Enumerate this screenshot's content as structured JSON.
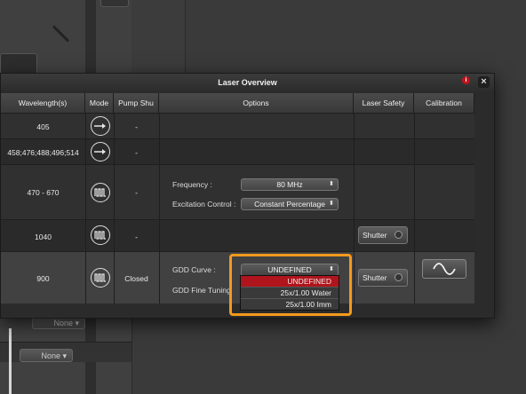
{
  "dialog": {
    "title": "Laser Overview",
    "info_glyph": "i",
    "close_glyph": "×"
  },
  "columns": [
    "Wavelength(s)",
    "Mode",
    "Pump Shu",
    "Options",
    "Laser Safety",
    "Calibration"
  ],
  "rows": [
    {
      "wavelength": "405",
      "mode_icon": "continuous-wave-icon",
      "pump_shutter": "-"
    },
    {
      "wavelength": "458;476;488;496;514",
      "mode_icon": "continuous-wave-icon",
      "pump_shutter": "-"
    },
    {
      "wavelength": "470 - 670",
      "mode_icon": "pulsed-icon",
      "pump_shutter": "-",
      "options": {
        "frequency_label": "Frequency :",
        "frequency_value": "80 MHz",
        "excitation_label": "Excitation Control :",
        "excitation_value": "Constant Percentage"
      }
    },
    {
      "wavelength": "1040",
      "mode_icon": "pulsed-icon",
      "pump_shutter": "-",
      "shutter_label": "Shutter"
    },
    {
      "wavelength": "900",
      "mode_icon": "pulsed-icon",
      "pump_shutter": "Closed",
      "options": {
        "gdd_curve_label": "GDD Curve :",
        "gdd_curve_value": "UNDEFINED",
        "gdd_fine_label": "GDD Fine Tuning"
      },
      "shutter_label": "Shutter",
      "calibration_icon": "sine-wave-icon"
    }
  ],
  "gdd_dropdown_options": [
    "UNDEFINED",
    "25x/1.00 Water",
    "25x/1.00 Imm"
  ],
  "gdd_dropdown_selected": "UNDEFINED",
  "background": {
    "select_1": "None",
    "select_2": "None"
  },
  "colors": {
    "highlight": "#f39a1d",
    "selected_option": "#b0141c"
  }
}
